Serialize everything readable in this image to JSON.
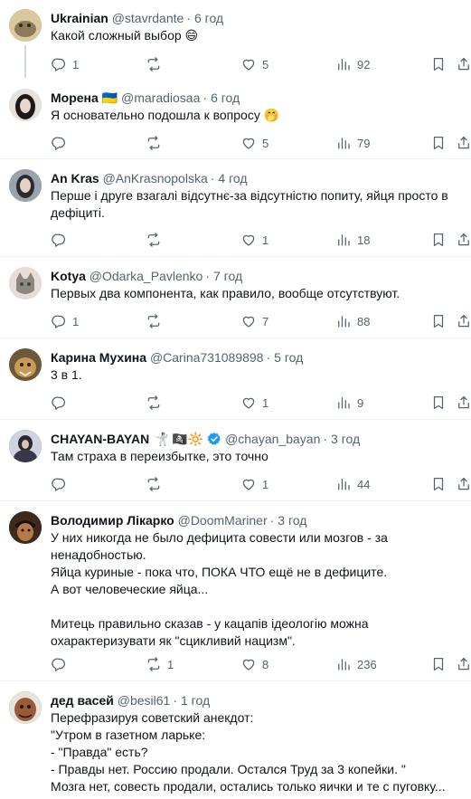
{
  "tweets": [
    {
      "name": "Ukrainian",
      "handle": "@stavrdante",
      "sep": "·",
      "time": "6 год",
      "text": "Какой сложный выбор 😄",
      "reply": "1",
      "retweet": "",
      "like": "5",
      "views": "92",
      "avatar_color": "#c9b48a",
      "thread": true
    },
    {
      "name": "Морена",
      "flag": "🇺🇦",
      "handle": "@maradiosaa",
      "sep": "·",
      "time": "6 год",
      "text": "Я основательно подошла к вопросу 🤭",
      "reply": "",
      "retweet": "",
      "like": "5",
      "views": "79",
      "avatar_color": "#d9d3cf"
    },
    {
      "name": "An Kras",
      "handle": "@AnKrasnopolska",
      "sep": "·",
      "time": "4 год",
      "text": "Перше і друге взагалі відсутнє-за відсутністю попиту, яйця просто в дефіциті.",
      "reply": "",
      "retweet": "",
      "like": "1",
      "views": "18",
      "avatar_color": "#7f8891"
    },
    {
      "name": "Kotya",
      "handle": "@Odarka_Pavlenko",
      "sep": "·",
      "time": "7 год",
      "text": "Первых два компонента, как правило, вообще отсутствуют.",
      "reply": "1",
      "retweet": "",
      "like": "7",
      "views": "88",
      "avatar_color": "#d7c9c5"
    },
    {
      "name": "Карина Мухина",
      "handle": "@Carina731089898",
      "sep": "·",
      "time": "5 год",
      "text": "3 в 1.",
      "reply": "",
      "retweet": "",
      "like": "1",
      "views": "9",
      "avatar_color": "#b08a4e"
    },
    {
      "name": "CHAYAN-BAYAN",
      "emojis": "🤺 🏴‍☠️🔆",
      "handle": "@chayan_bayan",
      "sep": "·",
      "time": "3 год",
      "text": "Там страха в переизбытке, это точно",
      "reply": "",
      "retweet": "",
      "like": "1",
      "views": "44",
      "avatar_color": "#3d3a46",
      "verified": true
    },
    {
      "name": "Володимир Лікарко",
      "handle": "@DoomMariner",
      "sep": "·",
      "time": "3 год",
      "text": "У них никогда не было дефицита совести или мозгов - за ненадобностью.\nЯйца куриные - пока что, ПОКА ЧТО ещё не в дефиците.\nА вот человеческие яйца...\n\nМитець правильно сказав - у кацапів ідеологію можна охарактеризувати як \"сцикливий нацизм\".",
      "reply": "",
      "retweet": "1",
      "like": "8",
      "views": "236",
      "avatar_color": "#6b4a2e"
    },
    {
      "name": "дед васей",
      "handle": "@besil61",
      "sep": "·",
      "time": "1 год",
      "text": "Перефразируя советский анекдот:\n\"Утром в газетном ларьке:\n- \"Правда\" есть?\n- Правды нет. Россию продали. Остался Труд за 3 копейки. \"\nМозга нет, совесть продали, остались только яички и те с пуговку...",
      "avatar_color": "#8a5a3c"
    }
  ]
}
